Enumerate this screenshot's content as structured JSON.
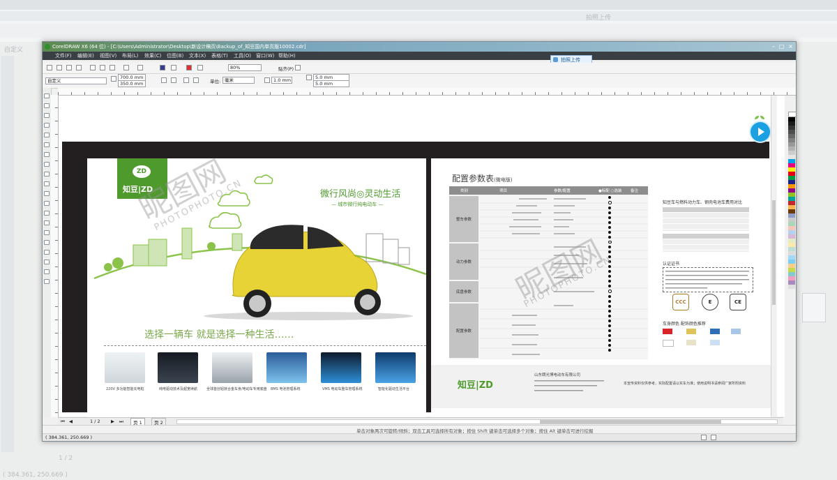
{
  "window": {
    "title": "CorelDRAW X6 (64 位) - [C:\\Users\\Administrator\\Desktop\\新设计稿页\\Backup_of_知豆国内单页版10002.cdr]",
    "upload_label": "拍照上传"
  },
  "menu": [
    "文件(F)",
    "编辑(E)",
    "视图(V)",
    "布局(L)",
    "效果(C)",
    "位图(B)",
    "文本(X)",
    "表格(T)",
    "工具(O)",
    "窗口(W)",
    "帮助(H)"
  ],
  "toolbar": {
    "zoom": "80%",
    "snap_label": "贴齐(P)",
    "preset": "自定义",
    "width": "700.0 mm",
    "height": "350.0 mm",
    "units_label": "单位:",
    "units_value": "毫米",
    "nudge": "1.0 mm",
    "dup_x": "5.0 mm",
    "dup_y": "5.0 mm"
  },
  "pages": {
    "counter": "1 / 2",
    "tab1": "页 1",
    "tab2": "页 2"
  },
  "status": {
    "hint": "单击对象两次可旋转/倾斜；双击工具可选择所有对象；按住 Shift 键单击可选择多个对象；按住 Alt 键单击可进行挖掘",
    "coords": "( 384.361, 250.669 )",
    "status_hint2": "单击/拖动可选择；在选定对象上单击，以便使用选择框选定对象"
  },
  "left_page": {
    "logo": "知豆|ZD",
    "logo_mark": "ZD",
    "slogan": "微行风尚◎灵动生活",
    "subslogan": "— 城市微行纯电动车 —",
    "tagline": "选择一辆车  就是选择一种生活……",
    "features": [
      "220V 多功能智能充电桩",
      "纯电驱动技术及超宽续航",
      "全球首创铝镁合金车身/电动车专用底盘",
      "BMS 电池管理系统",
      "VMS 电动车整车管理系统",
      "智能化驱动生活平台"
    ]
  },
  "right_page": {
    "title": "配置参数表",
    "title_sub": "(微电版)",
    "table_headers": [
      "类别",
      "项目",
      "参数/配置",
      "●标配 ○选装",
      "备注"
    ],
    "categories": [
      "整车参数",
      "动力参数",
      "底盘参数",
      "配置参数"
    ],
    "right_title1": "知豆车与燃料动力车、钢壳电池车费用对比",
    "right_title2": "认证证书",
    "right_title3": "车身颜色 配饰颜色推荐",
    "certs": [
      "CCC",
      "E",
      "CE"
    ],
    "footer_logo": "知豆|ZD",
    "company": "山东朗光博电动车有限公司",
    "footer_note": "本宣传资料仅供参考，实际配置请以实车为准；使用说明书请参阅厂家所附资料"
  },
  "watermark": "昵图网",
  "watermark_en": "PHOTOPHOTO.CN",
  "colors": {
    "brand_green": "#4e9a2c",
    "dark_frame": "#231f20",
    "play_blue": "#1ba1e2",
    "title_bar": "#5d8a4f"
  }
}
